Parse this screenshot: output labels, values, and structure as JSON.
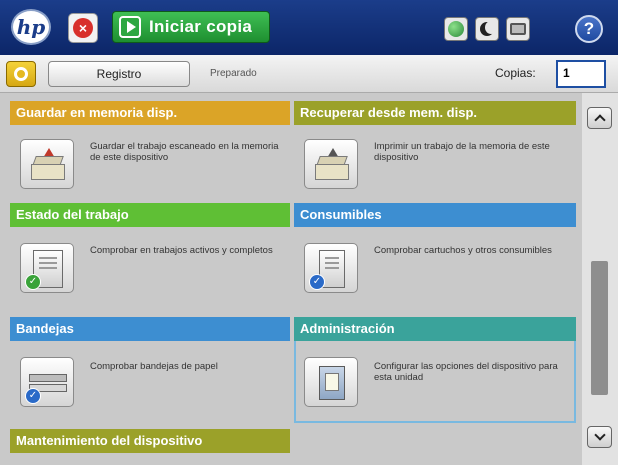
{
  "topbar": {
    "logo_text": "hp",
    "stop_icon": "stop-x-icon",
    "start_button_label": "Iniciar copia",
    "help_label": "?",
    "icons": [
      "network-globe-icon",
      "sleep-moon-icon",
      "network-status-icon"
    ]
  },
  "statusbar": {
    "home_icon": "home-icon",
    "log_button_label": "Registro",
    "status_text": "Preparado",
    "copies_label": "Copias:",
    "copies_value": "1"
  },
  "cards": [
    {
      "title": "Guardar en memoria disp.",
      "description": "Guardar el trabajo escaneado en la memoria de este dispositivo",
      "color": "#dba427",
      "icon": "scan-to-memory-icon"
    },
    {
      "title": "Recuperar desde mem. disp.",
      "description": "Imprimir un trabajo de la memoria de este dispositivo",
      "color": "#9ba129",
      "icon": "retrieve-from-memory-icon"
    },
    {
      "title": "Estado del trabajo",
      "description": "Comprobar en trabajos activos y completos",
      "color": "#5fbf35",
      "icon": "job-status-icon"
    },
    {
      "title": "Consumibles",
      "description": "Comprobar cartuchos y otros consumibles",
      "color": "#3d8ed1",
      "icon": "supplies-icon"
    },
    {
      "title": "Bandejas",
      "description": "Comprobar bandejas de papel",
      "color": "#3d8ed1",
      "icon": "trays-icon"
    },
    {
      "title": "Administración",
      "description": "Configurar las opciones del dispositivo para esta unidad",
      "color": "#3aa39b",
      "icon": "administration-icon"
    },
    {
      "title": "Mantenimiento del dispositivo",
      "description": "",
      "color": "#9ba129",
      "icon": "maintenance-icon"
    }
  ],
  "scrollbar": {
    "up_icon": "scroll-up-icon",
    "down_icon": "scroll-down-icon"
  }
}
